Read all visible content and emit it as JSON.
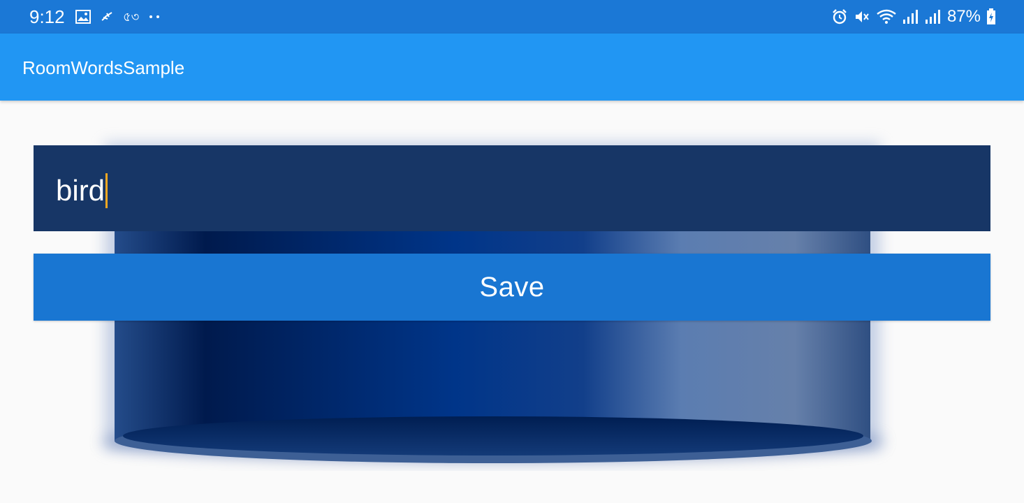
{
  "status_bar": {
    "time": "9:12",
    "left_icons": [
      "image-icon",
      "notification-icon",
      "bengali-glyph-icon",
      "more-dots-icon"
    ],
    "left_glyph_text": "৫৩",
    "right_icons": [
      "alarm-icon",
      "mute-icon",
      "wifi-icon",
      "signal-icon",
      "signal-icon",
      "battery-charging-icon"
    ],
    "battery_percent": "87%"
  },
  "app_bar": {
    "title": "RoomWordsSample"
  },
  "form": {
    "word_value": "bird",
    "save_label": "Save"
  },
  "colors": {
    "status_bar": "#1b78d6",
    "app_bar": "#2196f3",
    "input_background": "#173666",
    "save_button": "#1976d2",
    "caret": "#f6a821"
  }
}
